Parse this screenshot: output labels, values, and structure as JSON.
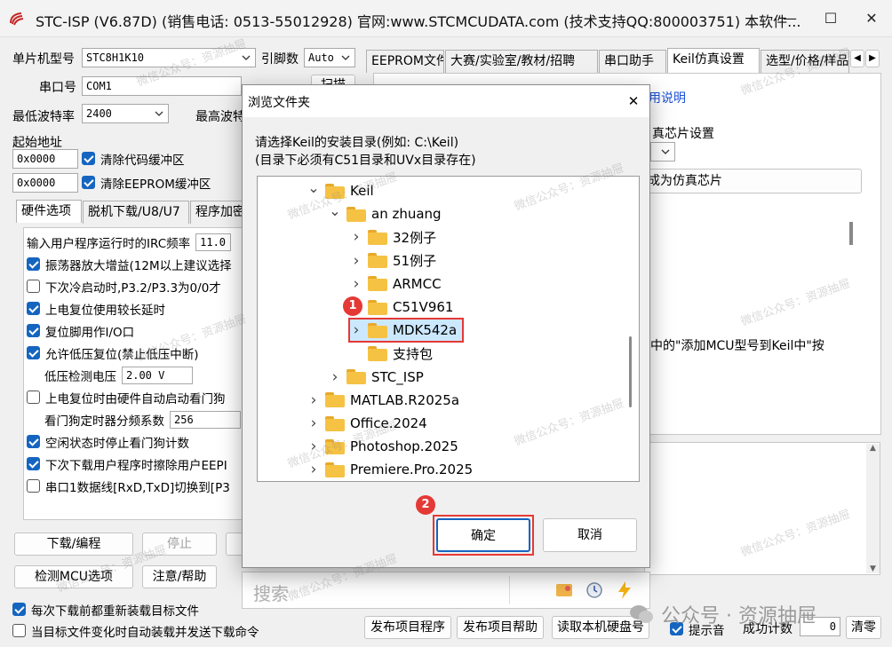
{
  "window": {
    "title": "STC-ISP (V6.87D) (销售电话: 0513-55012928) 官网:www.STCMCUDATA.com (技术支持QQ:800003751) 本软件...",
    "minimize": "—",
    "maximize": "☐",
    "close": "✕"
  },
  "left": {
    "mcu_label": "单片机型号",
    "mcu_value": "STC8H1K10",
    "pins_label": "引脚数",
    "pins_value": "Auto",
    "port_label": "串口号",
    "port_value": "COM1",
    "scan_btn": "扫描",
    "baud_min_label": "最低波特率",
    "baud_min_value": "2400",
    "baud_max_label": "最高波特",
    "start_addr_label": "起始地址",
    "addr1": "0x0000",
    "clear_code": "清除代码缓冲区",
    "addr2": "0x0000",
    "clear_eeprom": "清除EEPROM缓冲区",
    "tabs": [
      "硬件选项",
      "脱机下载/U8/U7",
      "程序加密"
    ],
    "options": [
      {
        "label": "输入用户程序运行时的IRC频率",
        "value": "11.0",
        "type": "input"
      },
      {
        "label": "振荡器放大增益(12M以上建议选择",
        "checked": true,
        "type": "check"
      },
      {
        "label": "下次冷启动时,P3.2/P3.3为0/0才",
        "checked": false,
        "type": "check"
      },
      {
        "label": "上电复位使用较长延时",
        "checked": true,
        "type": "check"
      },
      {
        "label": "复位脚用作I/O口",
        "checked": true,
        "type": "check"
      },
      {
        "label": "允许低压复位(禁止低压中断)",
        "checked": true,
        "type": "check"
      },
      {
        "label": "低压检测电压",
        "value": "2.00 V",
        "type": "select"
      },
      {
        "label": "上电复位时由硬件自动启动看门狗",
        "checked": false,
        "type": "check"
      },
      {
        "label": "看门狗定时器分频系数",
        "value": "256",
        "type": "select"
      },
      {
        "label": "空闲状态时停止看门狗计数",
        "checked": true,
        "type": "check"
      },
      {
        "label": "下次下载用户程序时擦除用户EEPI",
        "checked": true,
        "type": "check"
      },
      {
        "label": "串口1数据线[RxD,TxD]切换到[P3",
        "checked": false,
        "type": "check"
      }
    ],
    "download_btn": "下载/编程",
    "stop_btn": "停止",
    "detect_btn": "检测MCU选项",
    "help_btn": "注意/帮助",
    "reload_each": "每次下载前都重新装载目标文件",
    "auto_reload": "当目标文件变化时自动装载并发送下载命令"
  },
  "right": {
    "tabs": [
      "EEPROM文件",
      "大赛/实验室/教材/招聘",
      "串口助手",
      "Keil仿真设置",
      "选型/价格/样品"
    ],
    "usage_link": "用说明",
    "chip_setting": "真芯片设置",
    "as_emulator": "成为仿真芯片",
    "desc_text": "中的\"添加MCU型号到Keil中\"按",
    "publish_prog": "发布项目程序",
    "publish_help": "发布项目帮助",
    "read_hdd": "读取本机硬盘号",
    "beep_label": "提示音",
    "success_label": "成功计数",
    "success_value": "0",
    "clear_btn": "清零"
  },
  "search": {
    "placeholder": "搜索"
  },
  "dialog": {
    "title": "浏览文件夹",
    "close": "✕",
    "instruction1": "请选择Keil的安装目录(例如: C:\\Keil)",
    "instruction2": "(目录下必须有C51目录和UVx目录存在)",
    "tree": [
      {
        "name": "Keil",
        "level": 0,
        "expand": "open"
      },
      {
        "name": "an zhuang",
        "level": 1,
        "expand": "open"
      },
      {
        "name": "32例子",
        "level": 2,
        "expand": "closed"
      },
      {
        "name": "51例子",
        "level": 2,
        "expand": "closed"
      },
      {
        "name": "ARMCC",
        "level": 2,
        "expand": "closed"
      },
      {
        "name": "C51V961",
        "level": 2,
        "expand": "none"
      },
      {
        "name": "MDK542a",
        "level": 2,
        "expand": "closed",
        "selected": true
      },
      {
        "name": "支持包",
        "level": 2,
        "expand": "none"
      },
      {
        "name": "STC_ISP",
        "level": 1,
        "expand": "closed"
      },
      {
        "name": "MATLAB.R2025a",
        "level": 0,
        "expand": "closed"
      },
      {
        "name": "Office.2024",
        "level": 0,
        "expand": "closed"
      },
      {
        "name": "Photoshop.2025",
        "level": 0,
        "expand": "closed"
      },
      {
        "name": "Premiere.Pro.2025",
        "level": 0,
        "expand": "closed"
      }
    ],
    "ok_btn": "确定",
    "cancel_btn": "取消",
    "badge1": "1",
    "badge2": "2"
  },
  "overlay": {
    "watermark": "微信公众号：资源抽屉",
    "brand": "公众号 · 资源抽屉"
  },
  "colors": {
    "accent": "#1565c0",
    "highlight_border": "#e53935",
    "selected_bg": "#cce8ff",
    "folder": "#f6c244"
  }
}
